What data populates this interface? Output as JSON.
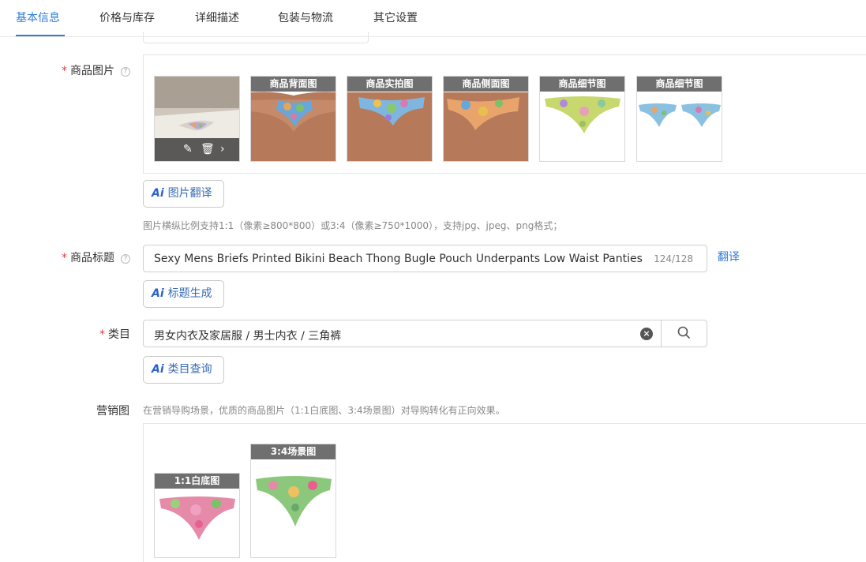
{
  "tabs": [
    "基本信息",
    "价格与库存",
    "详细描述",
    "包装与物流",
    "其它设置"
  ],
  "product_images": {
    "label": "商品图片",
    "required_mark": "*",
    "help_icon": "question-circle-icon",
    "thumbnails": [
      "",
      "商品背面图",
      "商品实拍图",
      "商品侧面图",
      "商品细节图",
      "商品细节图"
    ],
    "overlay_icons": [
      "edit-icon",
      "delete-icon",
      "chevron-right-icon"
    ],
    "ai_button": "图片翻译",
    "ai_mark": "Ai",
    "hint": "图片横纵比例支持1:1（像素≥800*800）或3:4（像素≥750*1000），支持jpg、jpeg、png格式；"
  },
  "product_title": {
    "label": "商品标题",
    "required_mark": "*",
    "value": "Sexy Mens Briefs Printed Bikini Beach Thong Bugle Pouch Underpants Low Waist Panties High Cut",
    "counter": "124/128",
    "translate_link": "翻译",
    "ai_button": "标题生成"
  },
  "category": {
    "label": "类目",
    "required_mark": "*",
    "value": "男女内衣及家居服 / 男士内衣 / 三角裤",
    "clear_icon": "clear-circle-icon",
    "search_icon": "search-icon",
    "ai_button": "类目查询"
  },
  "marketing": {
    "label": "营销图",
    "hint": "在营销导购场景，优质的商品图片（1:1白底图、3:4场景图）对导购转化有正向效果。",
    "images": [
      "1:1白底图",
      "3:4场景图"
    ]
  },
  "colors": {
    "accent": "#2f7bd6",
    "required": "#e4393c",
    "caption_bg": "#6f6f6f"
  }
}
